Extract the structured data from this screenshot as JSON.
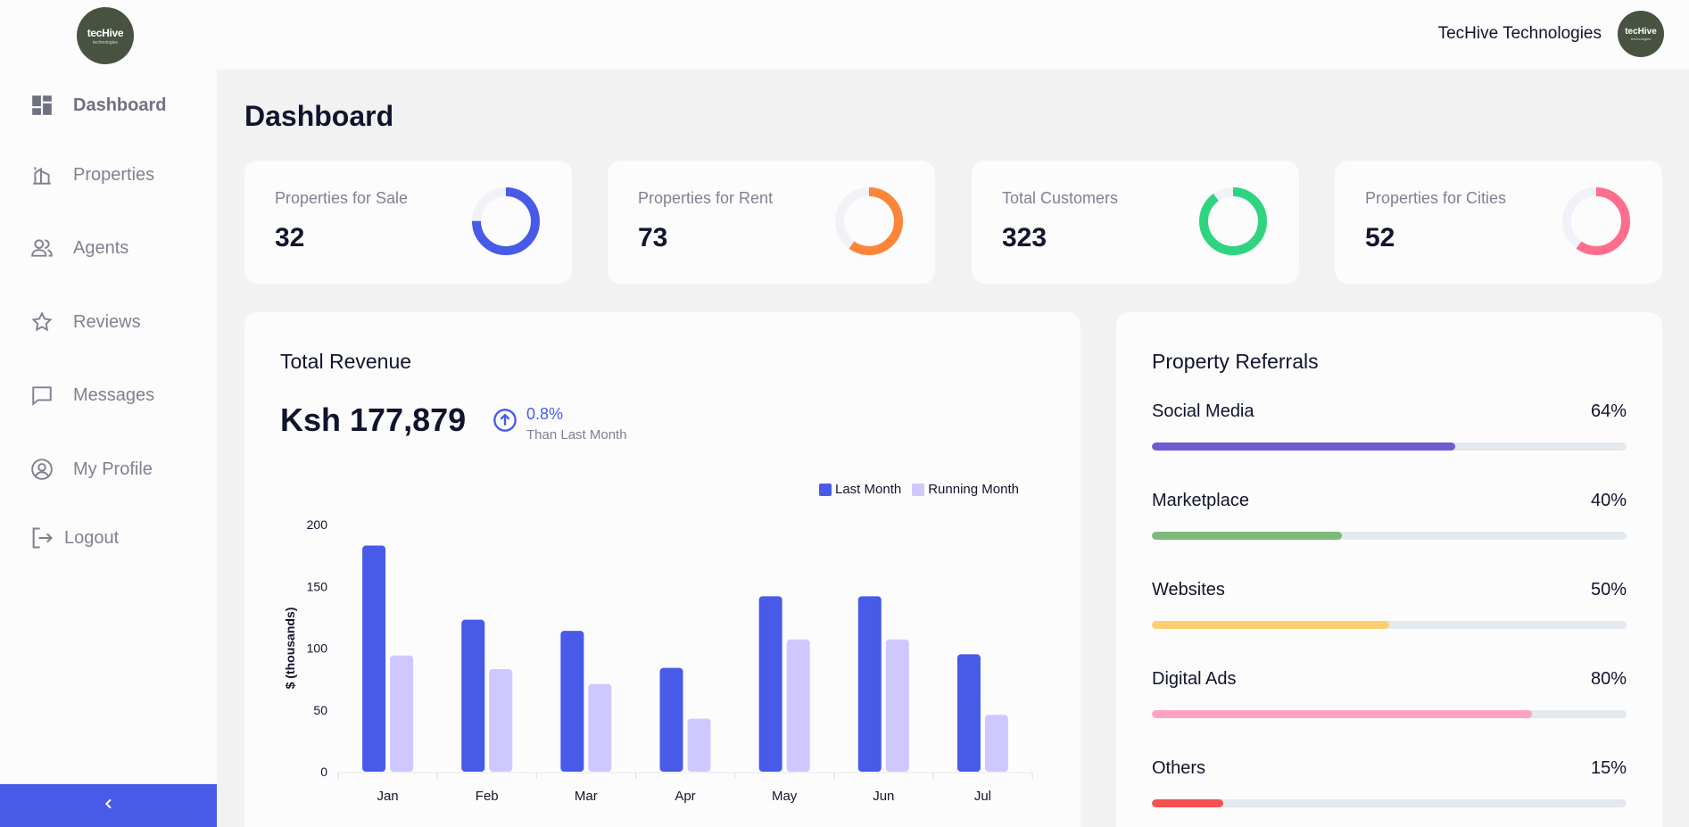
{
  "app": {
    "logo_text": "tecHive",
    "logo_subtext": "technologies",
    "company_name": "TecHive Technologies"
  },
  "sidebar": {
    "items": [
      {
        "label": "Dashboard",
        "icon": "dashboard-icon",
        "active": true
      },
      {
        "label": "Properties",
        "icon": "building-icon"
      },
      {
        "label": "Agents",
        "icon": "users-icon"
      },
      {
        "label": "Reviews",
        "icon": "star-icon"
      },
      {
        "label": "Messages",
        "icon": "message-icon"
      },
      {
        "label": "My Profile",
        "icon": "user-circle-icon"
      },
      {
        "label": "Logout",
        "icon": "logout-icon"
      }
    ],
    "collapse_icon": "chevron-left-icon"
  },
  "page": {
    "title": "Dashboard"
  },
  "stats": [
    {
      "label": "Properties for Sale",
      "value": "32",
      "color": "#475be8",
      "fraction": 0.75
    },
    {
      "label": "Properties for Rent",
      "value": "73",
      "color": "#fd8539",
      "fraction": 0.6
    },
    {
      "label": "Total Customers",
      "value": "323",
      "color": "#2ed480",
      "fraction": 0.9
    },
    {
      "label": "Properties for Cities",
      "value": "52",
      "color": "#fe6d8e",
      "fraction": 0.6
    }
  ],
  "revenue": {
    "title": "Total Revenue",
    "amount": "Ksh 177,879",
    "trend_pct": "0.8%",
    "trend_label": "Than Last Month",
    "trend_icon": "arrow-up-circle-icon",
    "legend": [
      {
        "name": "Last Month",
        "color": "#475be8"
      },
      {
        "name": "Running Month",
        "color": "#cfc8ff"
      }
    ]
  },
  "chart_data": {
    "type": "bar",
    "categories": [
      "Jan",
      "Feb",
      "Mar",
      "Apr",
      "May",
      "Jun",
      "Jul"
    ],
    "series": [
      {
        "name": "Last Month",
        "values": [
          183,
          123,
          114,
          84,
          142,
          142,
          95
        ],
        "color": "#475be8"
      },
      {
        "name": "Running Month",
        "values": [
          94,
          83,
          71,
          43,
          107,
          107,
          46
        ],
        "color": "#cfc8ff"
      }
    ],
    "ylabel": "$ (thousands)",
    "ylim": [
      0,
      200
    ],
    "yticks": [
      0,
      50,
      100,
      150,
      200
    ],
    "legend_position": "top-right",
    "grid": false
  },
  "referrals": {
    "title": "Property Referrals",
    "items": [
      {
        "name": "Social Media",
        "pct_label": "64%",
        "pct": 64,
        "color": "#6c5dd3"
      },
      {
        "name": "Marketplace",
        "pct_label": "40%",
        "pct": 40,
        "color": "#7fba7a"
      },
      {
        "name": "Websites",
        "pct_label": "50%",
        "pct": 50,
        "color": "#ffce73"
      },
      {
        "name": "Digital Ads",
        "pct_label": "80%",
        "pct": 80,
        "color": "#ffa2c0"
      },
      {
        "name": "Others",
        "pct_label": "15%",
        "pct": 15,
        "color": "#f45252"
      }
    ]
  }
}
